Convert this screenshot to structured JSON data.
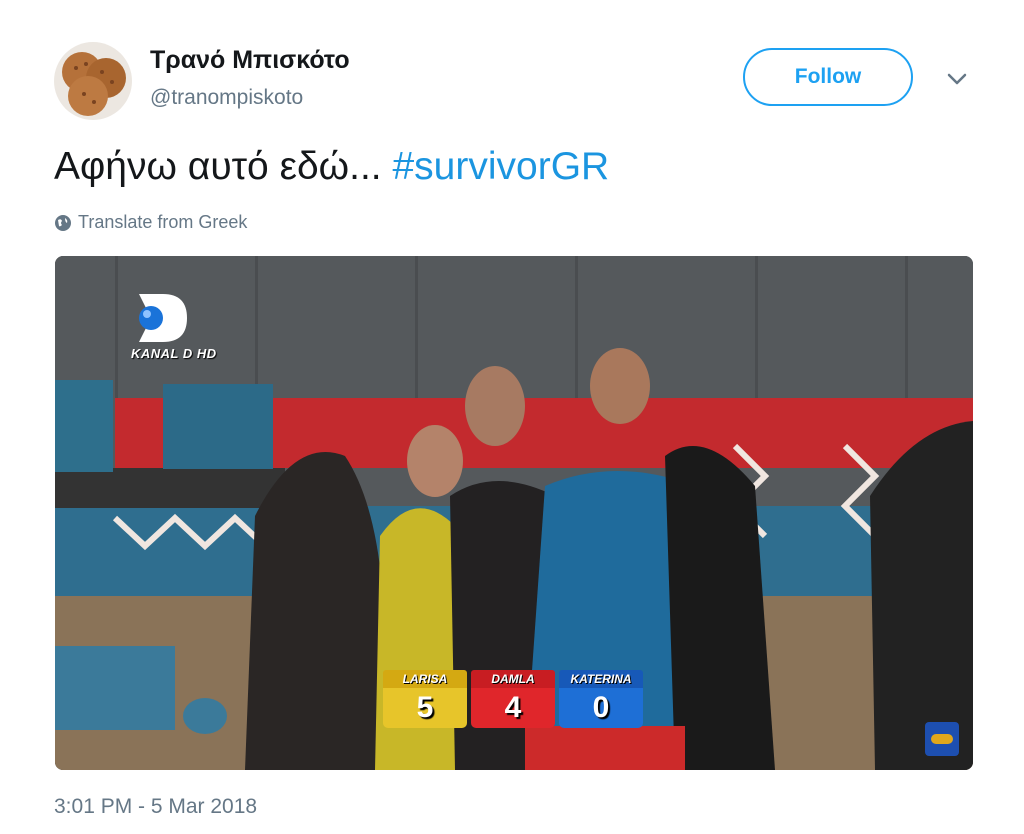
{
  "author": {
    "name": "Τρανό Μπισκότο",
    "handle": "@tranompiskoto",
    "avatar_icon": "cookie-avatar"
  },
  "follow_label": "Follow",
  "tweet": {
    "text": "Αφήνω αυτό εδώ... ",
    "hashtag": "#survivorGR"
  },
  "translate_label": "Translate from Greek",
  "media": {
    "channel_logo_text": "KANAL D HD",
    "scores": [
      {
        "name": "LARISA",
        "value": "5",
        "color": "#e7c52a"
      },
      {
        "name": "DAMLA",
        "value": "4",
        "color": "#e0262b"
      },
      {
        "name": "KATERINA",
        "value": "0",
        "color": "#1e6fd6"
      }
    ]
  },
  "timestamp": "3:01 PM - 5 Mar 2018",
  "colors": {
    "accent": "#1da1f2",
    "hashtag": "#1b95e0",
    "secondary_text": "#657786"
  }
}
